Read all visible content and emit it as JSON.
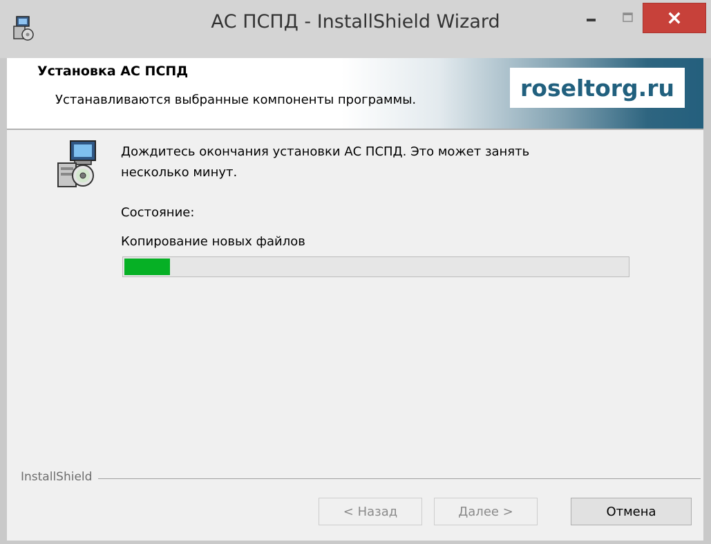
{
  "window": {
    "title": "АС ПСПД - InstallShield Wizard",
    "controls": {
      "minimize": "–",
      "maximize": "□",
      "close": "×"
    }
  },
  "header": {
    "title": "Установка АС ПСПД",
    "subtitle": "Устанавливаются выбранные компоненты программы.",
    "logo": "roseltorg.ru",
    "logo_color": "#21607e"
  },
  "content": {
    "message": "Дождитесь окончания установки АС ПСПД. Это может занять несколько минут.",
    "status_label": "Состояние:",
    "status_value": "Копирование новых файлов",
    "progress_percent": 9,
    "progress_color": "#06b025"
  },
  "footer": {
    "brand": "InstallShield",
    "back_label": "< Назад",
    "next_label": "Далее >",
    "cancel_label": "Отмена"
  },
  "icons": {
    "app": "installer-icon",
    "setup": "computer-cd-icon"
  }
}
